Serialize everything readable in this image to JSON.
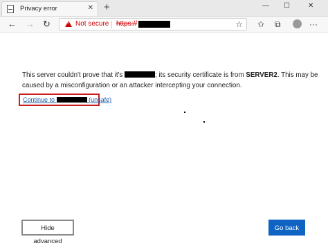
{
  "tab": {
    "title": "Privacy error",
    "close": "✕"
  },
  "window": {
    "new_tab": "+",
    "minimize": "—",
    "maximize": "☐",
    "close": "✕"
  },
  "toolbar": {
    "back": "←",
    "forward": "→",
    "refresh": "↻",
    "not_secure": "Not secure",
    "url_scheme": "https://",
    "star": "☆",
    "favorites": "✩",
    "collections": "⧉",
    "menu": "···"
  },
  "page": {
    "msg_part1": "This server couldn't prove that it's",
    "msg_part2": "; its security certificate is from",
    "server": "SERVER2",
    "msg_part3": ". This may be caused by a misconfiguration or an attacker intercepting your connection.",
    "continue_prefix": "Continue to",
    "continue_suffix": "(unsafe)",
    "hide_advanced": "Hide advanced",
    "go_back": "Go back"
  },
  "colors": {
    "warning": "#cc0000",
    "link": "#1a5aa8",
    "highlight_box": "#c91c1c",
    "primary_button": "#0f63c2"
  },
  "icons": {
    "page": "page-icon",
    "warning": "warning-triangle-icon",
    "favorite": "star-icon",
    "profile": "avatar"
  }
}
